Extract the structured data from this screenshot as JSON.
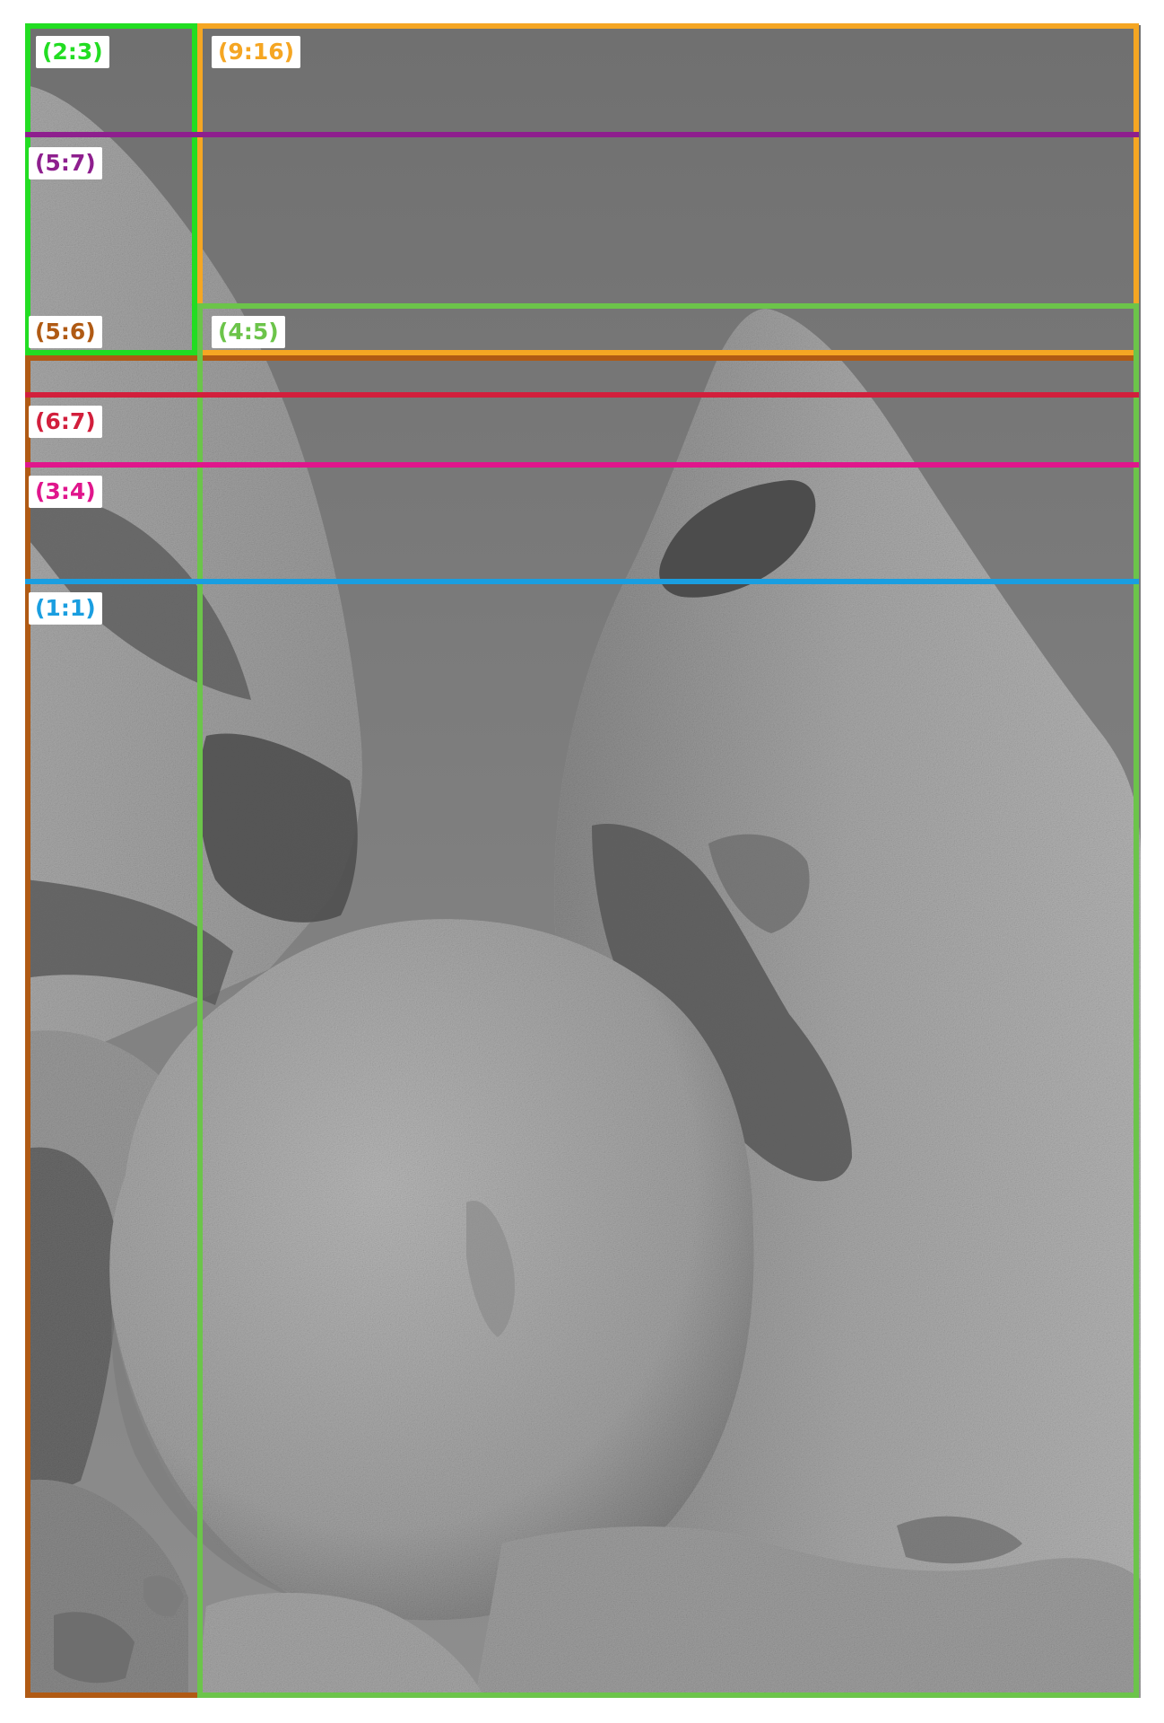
{
  "image": {
    "subject": "black-and-white photo of rounded granite boulders under a plain sky",
    "palette": {
      "sky": "#7c7c7c",
      "rock": "#a9a9a9",
      "shadow": "#555555",
      "frame": "#ffffff"
    }
  },
  "overlays": [
    {
      "label": "(2:3)",
      "color": "#22dd22"
    },
    {
      "label": "(9:16)",
      "color": "#f5a623"
    },
    {
      "label": "(5:7)",
      "color": "#8e1f8e"
    },
    {
      "label": "(5:6)",
      "color": "#b05a14"
    },
    {
      "label": "(4:5)",
      "color": "#6cc44a"
    },
    {
      "label": "(6:7)",
      "color": "#d21f3c"
    },
    {
      "label": "(3:4)",
      "color": "#e0168c"
    },
    {
      "label": "(1:1)",
      "color": "#1a9ee0"
    }
  ]
}
